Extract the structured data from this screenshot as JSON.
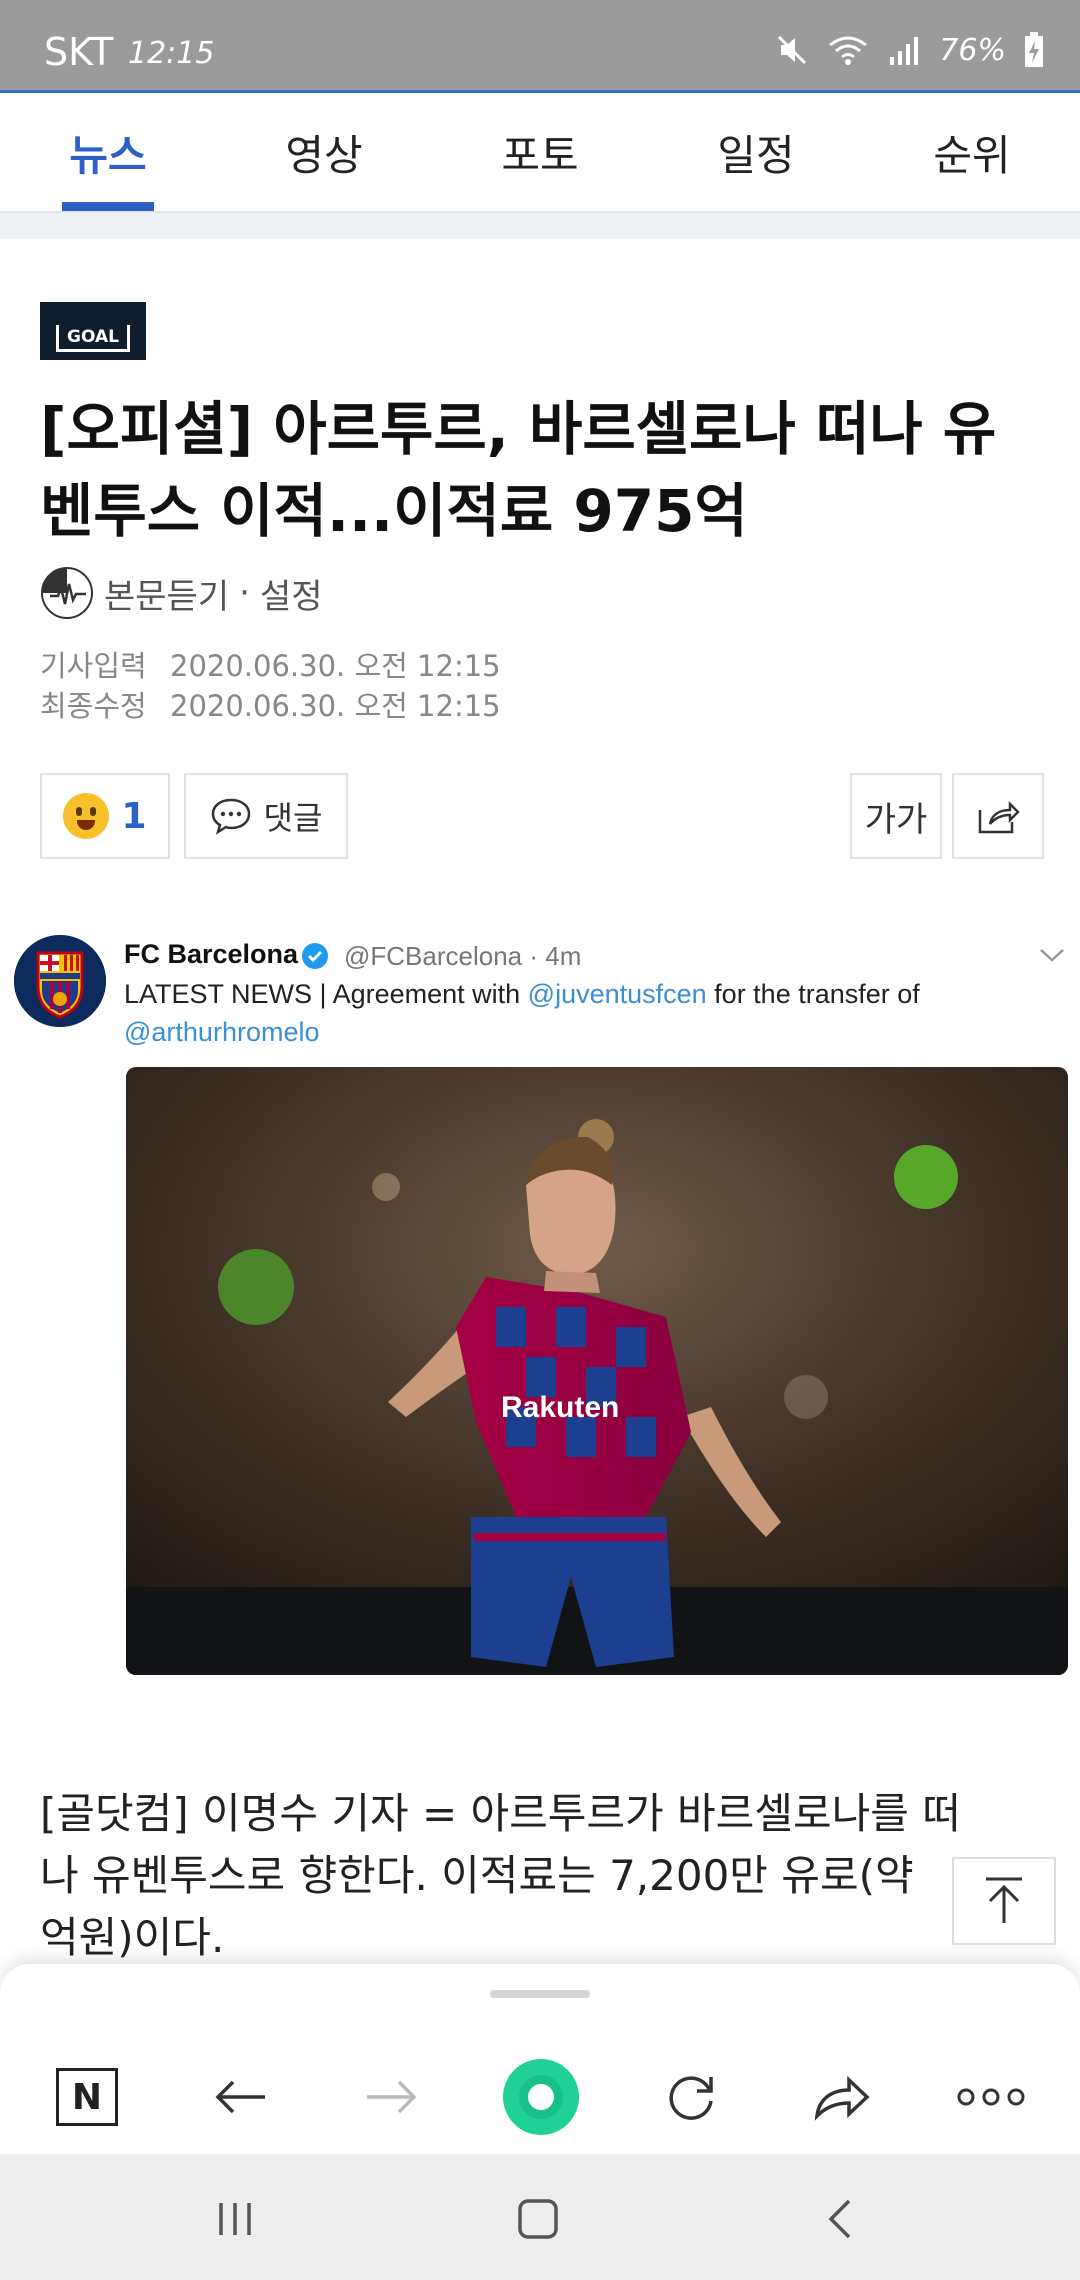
{
  "status_bar": {
    "carrier": "SKT",
    "time": "12:15",
    "battery": "76%"
  },
  "tabs": [
    {
      "label": "뉴스",
      "active": true
    },
    {
      "label": "영상",
      "active": false
    },
    {
      "label": "포토",
      "active": false
    },
    {
      "label": "일정",
      "active": false
    },
    {
      "label": "순위",
      "active": false
    }
  ],
  "article": {
    "source_logo": "GOAL",
    "headline_line1": "[오피셜] 아르투르, 바르셀로나 떠나 유",
    "headline_line2": "벤투스 이적...이적료 975억",
    "listen_label": "본문듣기",
    "settings_label": "설정",
    "input_label": "기사입력",
    "input_date": "2020.06.30. 오전 12:15",
    "modified_label": "최종수정",
    "modified_date": "2020.06.30. 오전 12:15",
    "reaction_count": "1",
    "comment_label": "댓글",
    "font_size_label": "가가",
    "body_line1": "[골닷컴] 이명수 기자 = 아르투르가 바르셀로나를 떠",
    "body_line2": "나 유벤투스로 향한다. 이적료는 7,200만 유로(약",
    "body_line3": "억원)이다."
  },
  "tweet": {
    "name": "FC Barcelona",
    "handle_time": "@FCBarcelona · 4m",
    "text_prefix": "LATEST NEWS | Agreement with ",
    "mention1": "@juventusfcen",
    "text_middle": " for the transfer of",
    "mention2": "@arthurhromelo",
    "shirt_sponsor": "Rakuten"
  },
  "toolbar": {
    "home_label": "N"
  },
  "colors": {
    "accent": "#2d5fc6",
    "green": "#1fd197",
    "link": "#3a8fd6"
  }
}
